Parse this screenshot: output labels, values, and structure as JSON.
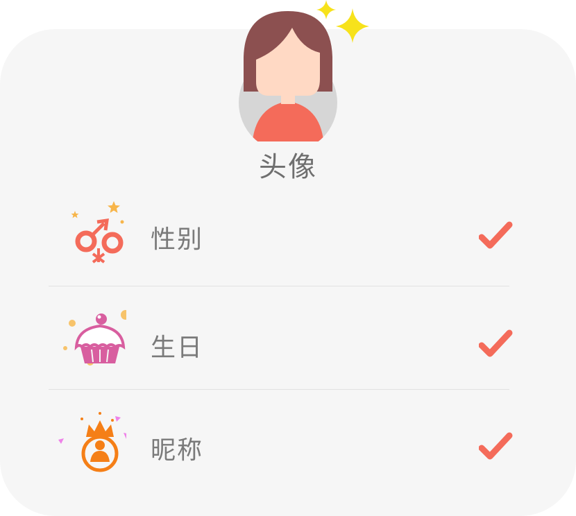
{
  "profile": {
    "avatar_label": "头像"
  },
  "fields": [
    {
      "label": "性别",
      "icon": "gender-icon",
      "checked": true
    },
    {
      "label": "生日",
      "icon": "cupcake-icon",
      "checked": true
    },
    {
      "label": "昵称",
      "icon": "crown-user-icon",
      "checked": true
    }
  ],
  "colors": {
    "card_bg": "#f6f6f6",
    "check": "#f46b5a",
    "label_text": "#7a7a7a",
    "sparkle": "#f7e21b"
  }
}
